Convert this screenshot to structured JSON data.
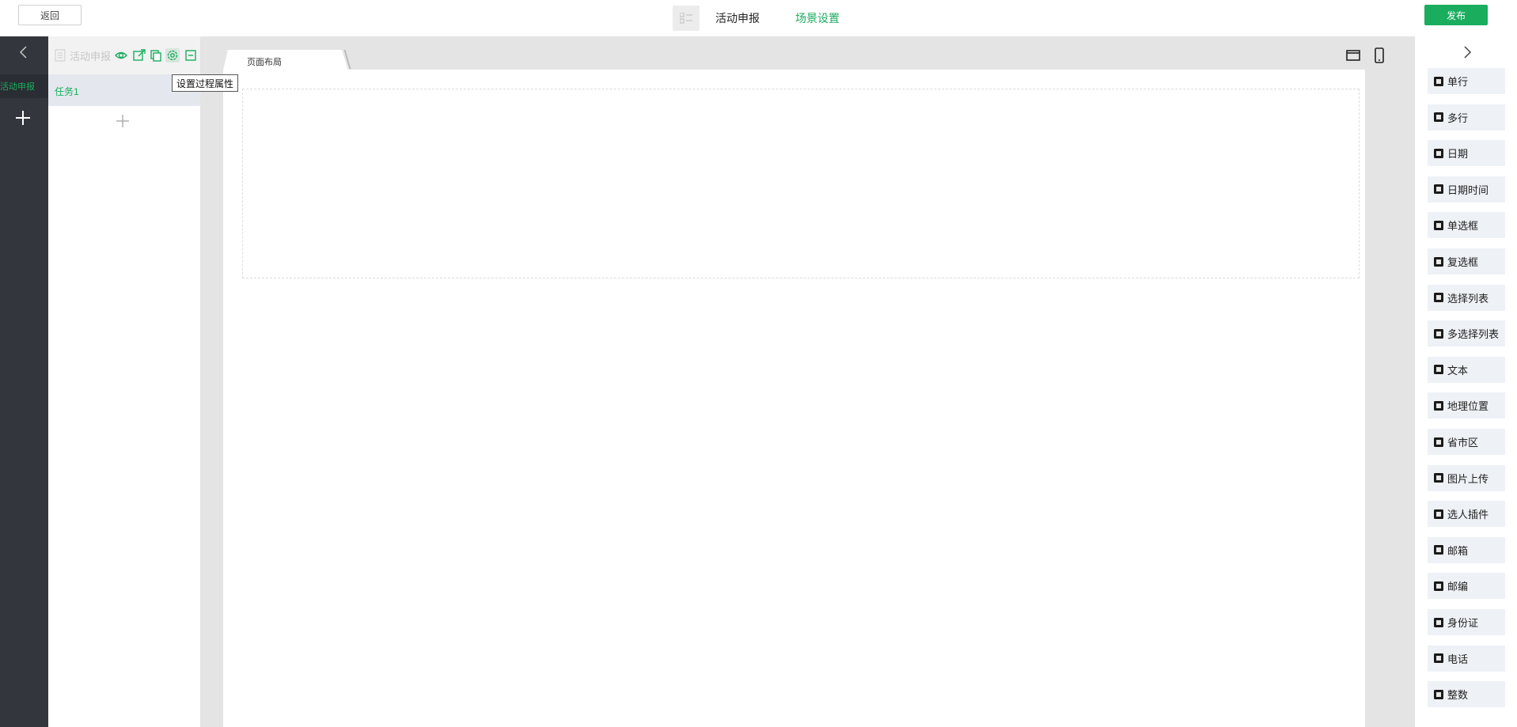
{
  "topbar": {
    "back_label": "返回",
    "app_title": "活动申报",
    "scene_settings": "场景设置",
    "publish_label": "发布"
  },
  "left_strip": {
    "item_label": "活动申报"
  },
  "panel": {
    "title": "活动申报",
    "task_label": "任务1",
    "tooltip": "设置过程属性",
    "tools": [
      "eye-icon",
      "external-link-icon",
      "copy-icon",
      "gear-icon",
      "minus-square-icon"
    ]
  },
  "canvas": {
    "tab_label": "页面布局"
  },
  "components": [
    {
      "label": "单行",
      "icon": "single-line-icon"
    },
    {
      "label": "多行",
      "icon": "multi-line-icon"
    },
    {
      "label": "日期",
      "icon": "calendar-icon"
    },
    {
      "label": "日期时间",
      "icon": "calendar-clock-icon"
    },
    {
      "label": "单选框",
      "icon": "radio-icon"
    },
    {
      "label": "复选框",
      "icon": "checkbox-icon"
    },
    {
      "label": "选择列表",
      "icon": "grid-icon"
    },
    {
      "label": "多选择列表",
      "icon": "list-icon"
    },
    {
      "label": "文本",
      "icon": "edit-icon"
    },
    {
      "label": "地理位置",
      "icon": "location-icon"
    },
    {
      "label": "省市区",
      "icon": "map-icon"
    },
    {
      "label": "图片上传",
      "icon": "image-upload-icon"
    },
    {
      "label": "选人插件",
      "icon": "person-picker-icon"
    },
    {
      "label": "邮箱",
      "icon": "mail-icon"
    },
    {
      "label": "邮编",
      "icon": "postcode-icon"
    },
    {
      "label": "身份证",
      "icon": "id-card-icon"
    },
    {
      "label": "电话",
      "icon": "phone-icon"
    },
    {
      "label": "整数",
      "icon": "number-icon"
    }
  ],
  "colors": {
    "accent": "#1aad5e",
    "dark_sidebar": "#33363d",
    "canvas_bg": "#e4e4e4"
  }
}
